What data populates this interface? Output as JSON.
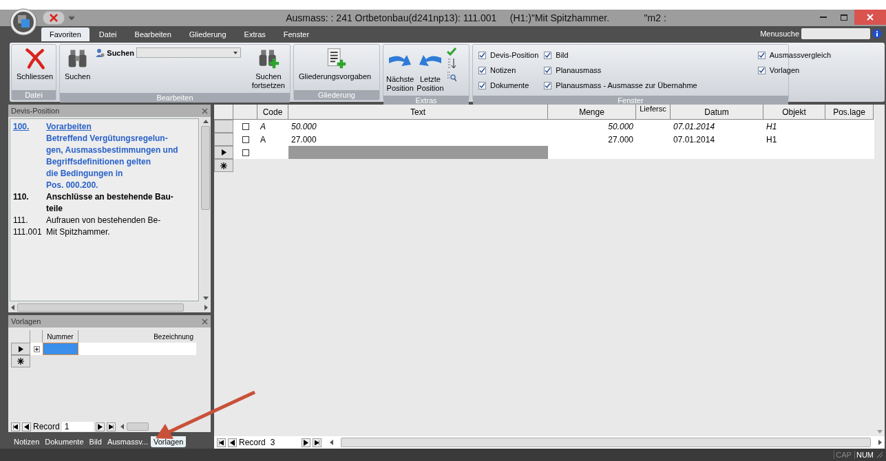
{
  "title_bar": {
    "title": "Ausmass: : 241 Ortbetonbau(d241np13): 111.001     (H1:)\"Mit Spitzhammer.             \"m2 :"
  },
  "menu_tabs": [
    {
      "label": "Favoriten",
      "selected": true
    },
    {
      "label": "Datei",
      "selected": false
    },
    {
      "label": "Bearbeiten",
      "selected": false
    },
    {
      "label": "Gliederung",
      "selected": false
    },
    {
      "label": "Extras",
      "selected": false
    },
    {
      "label": "Fenster",
      "selected": false
    }
  ],
  "menu_search": {
    "label": "Menusuche"
  },
  "ribbon": {
    "groups": [
      {
        "kind": "close",
        "title": "Datei",
        "buttons": [
          "Schliessen"
        ]
      },
      {
        "kind": "search",
        "title": "Bearbeiten",
        "buttons": [
          "Suchen",
          "Suchen fortsetzen"
        ],
        "search_label": "Suchen"
      },
      {
        "kind": "outline",
        "title": "Gliederung",
        "buttons": [
          "Gliederungsvorgaben"
        ]
      },
      {
        "kind": "navigate",
        "title": "Extras",
        "buttons": [
          "Nächste Position",
          "Letzte Position"
        ]
      },
      {
        "kind": "windows",
        "title": "Fenster",
        "options": [
          {
            "label": "Devis-Position",
            "checked": true
          },
          {
            "label": "Notizen",
            "checked": true
          },
          {
            "label": "Dokumente",
            "checked": true
          },
          {
            "label": "Bild",
            "checked": true
          },
          {
            "label": "Planausmass",
            "checked": true
          },
          {
            "label": "Planausmass - Ausmasse zur Übernahme",
            "checked": true
          },
          {
            "label": "Ausmassvergleich",
            "checked": true
          },
          {
            "label": "Vorlagen",
            "checked": true
          }
        ]
      }
    ]
  },
  "devis_panel": {
    "title": "Devis-Position",
    "entries": [
      {
        "number": "100.",
        "kind": "selected",
        "lines": [
          "Vorarbeiten",
          "Betreffend Vergütungsregelun-",
          "gen, Ausmassbestimmungen und",
          "Begriffsdefinitionen gelten",
          "die Bedingungen in",
          "Pos. 000.200."
        ]
      },
      {
        "number": "110.",
        "kind": "heading",
        "lines": [
          "Anschlüsse an bestehende Bau-",
          "teile"
        ]
      },
      {
        "number": "111.",
        "kind": "normal",
        "lines": [
          "Aufrauen von bestehenden Be-"
        ]
      },
      {
        "number": "111.001",
        "kind": "normal",
        "lines": [
          "Mit Spitzhammer."
        ]
      }
    ]
  },
  "vorlagen_panel": {
    "title": "Vorlagen",
    "columns": [
      "Nummer",
      "Bezeichnung"
    ],
    "rows": [
      {
        "current": true,
        "selected": true
      }
    ],
    "record_label": "Record",
    "record": "1"
  },
  "bottom_tabs": [
    {
      "label": "Notizen",
      "selected": false
    },
    {
      "label": "Dokumente",
      "selected": false
    },
    {
      "label": "Bild",
      "selected": false
    },
    {
      "label": "Ausmassv...",
      "selected": false
    },
    {
      "label": "Vorlagen",
      "selected": true
    }
  ],
  "table": {
    "columns": [
      "Code",
      "Text",
      "Menge",
      "Liefersc",
      "Datum",
      "Objekt",
      "Pos.lage"
    ],
    "rows": [
      {
        "current": false,
        "checked": false,
        "emphasized": true,
        "code": "A",
        "text": "50.000",
        "menge": "50.000",
        "datum": "07.01.2014",
        "objekt": "H1"
      },
      {
        "current": false,
        "checked": false,
        "emphasized": false,
        "code": "A",
        "text": "27.000",
        "menge": "27.000",
        "datum": "07.01.2014",
        "objekt": "H1"
      },
      {
        "current": true,
        "checked": false,
        "emphasized": false
      }
    ],
    "record_label": "Record",
    "record": "3"
  },
  "status_bar": [
    {
      "label": "CAP",
      "on": false
    },
    {
      "label": "NUM",
      "on": true
    }
  ]
}
